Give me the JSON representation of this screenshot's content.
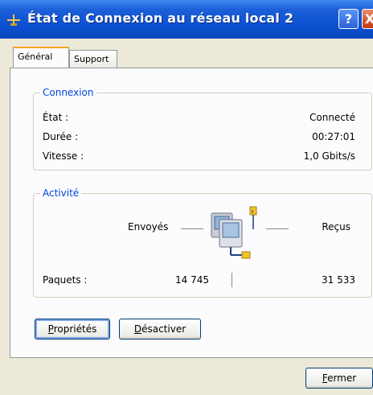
{
  "window": {
    "title": "État de Connexion au réseau local 2",
    "help_label": "?",
    "close_label": "X"
  },
  "tabs": [
    {
      "label": "Général"
    },
    {
      "label": "Support"
    }
  ],
  "connexion": {
    "title": "Connexion",
    "rows": [
      {
        "label": "État :",
        "value": "Connecté"
      },
      {
        "label": "Durée :",
        "value": "00:27:01"
      },
      {
        "label": "Vitesse :",
        "value": "1,0 Gbits/s"
      }
    ]
  },
  "activite": {
    "title": "Activité",
    "sent_label": "Envoyés",
    "received_label": "Reçus",
    "packets_label": "Paquets :",
    "packets_sent": "14 745",
    "packets_received": "31 533"
  },
  "buttons": {
    "properties": {
      "accel": "P",
      "rest": "ropriétés"
    },
    "disable": {
      "accel": "D",
      "rest": "ésactiver"
    },
    "close": {
      "accel": "F",
      "rest": "ermer"
    }
  }
}
